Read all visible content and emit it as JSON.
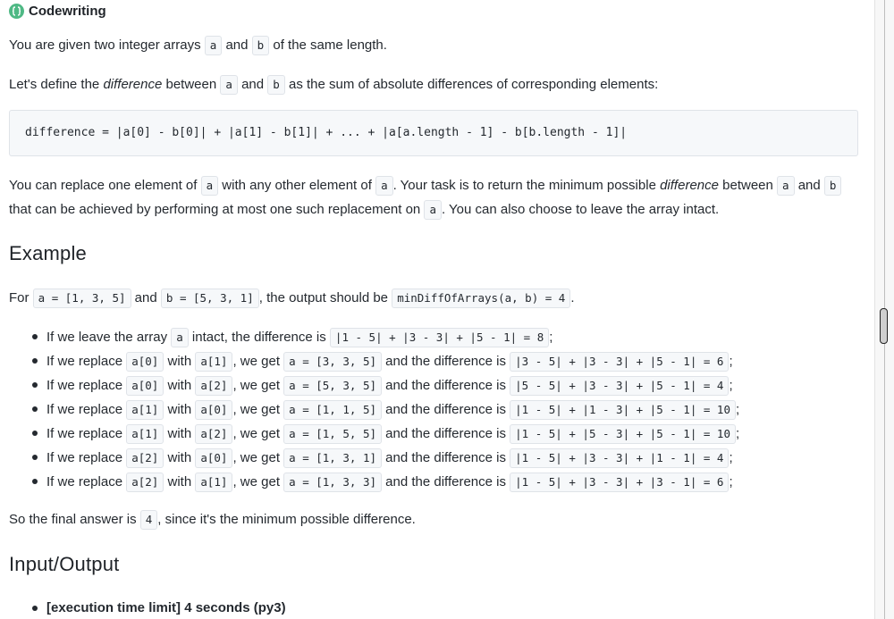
{
  "header": {
    "title": "Codewriting",
    "icon": "codewriting-logo-icon",
    "accent": "#4fb985"
  },
  "intro": {
    "t1": "You are given two integer arrays ",
    "c1": "a",
    "t2": " and ",
    "c2": "b",
    "t3": " of the same length."
  },
  "definition": {
    "t1": "Let's define the ",
    "em": "difference",
    "t2": " between ",
    "c1": "a",
    "t3": " and ",
    "c2": "b",
    "t4": " as the sum of absolute differences of corresponding elements:"
  },
  "codeblock": "difference = |a[0] - b[0]| + |a[1] - b[1]| + ... + |a[a.length - 1] - b[b.length - 1]|",
  "task": {
    "l1_t1": "You can replace one element of ",
    "l1_c1": "a",
    "l1_t2": " with any other element of ",
    "l1_c2": "a",
    "l1_t3": ". Your task is to return the minimum possible ",
    "l1_em": "difference",
    "l1_t4": " between ",
    "l1_c3": "a",
    "l1_t5": " and ",
    "l1_c4": "b",
    "l2_t1": "that can be achieved by performing at most one such replacement on ",
    "l2_c1": "a",
    "l2_t2": ". You can also choose to leave the array intact."
  },
  "example": {
    "heading": "Example",
    "t1": "For ",
    "c1": "a = [1, 3, 5]",
    "t2": " and ",
    "c2": "b = [5, 3, 1]",
    "t3": ", the output should be ",
    "c3": "minDiffOfArrays(a, b) = 4",
    "t4": ".",
    "items": [
      {
        "t1": "If we leave the array ",
        "c1": "a",
        "t2": " intact, the difference is ",
        "c2": "|1 - 5| + |3 - 3| + |5 - 1| = 8",
        "t3": ";"
      },
      {
        "t1": "If we replace ",
        "c1": "a[0]",
        "t2": " with ",
        "c2": "a[1]",
        "t3": ", we get ",
        "c3": "a = [3, 3, 5]",
        "t4": " and the difference is ",
        "c4": "|3 - 5| + |3 - 3| + |5 - 1| = 6",
        "t5": ";"
      },
      {
        "t1": "If we replace ",
        "c1": "a[0]",
        "t2": " with ",
        "c2": "a[2]",
        "t3": ", we get ",
        "c3": "a = [5, 3, 5]",
        "t4": " and the difference is ",
        "c4": "|5 - 5| + |3 - 3| + |5 - 1| = 4",
        "t5": ";"
      },
      {
        "t1": "If we replace ",
        "c1": "a[1]",
        "t2": " with ",
        "c2": "a[0]",
        "t3": ", we get ",
        "c3": "a = [1, 1, 5]",
        "t4": " and the difference is ",
        "c4": "|1 - 5| + |1 - 3| + |5 - 1| = 10",
        "t5": ";"
      },
      {
        "t1": "If we replace ",
        "c1": "a[1]",
        "t2": " with ",
        "c2": "a[2]",
        "t3": ", we get ",
        "c3": "a = [1, 5, 5]",
        "t4": " and the difference is ",
        "c4": "|1 - 5| + |5 - 3| + |5 - 1| = 10",
        "t5": ";"
      },
      {
        "t1": "If we replace ",
        "c1": "a[2]",
        "t2": " with ",
        "c2": "a[0]",
        "t3": ", we get ",
        "c3": "a = [1, 3, 1]",
        "t4": " and the difference is ",
        "c4": "|1 - 5| + |3 - 3| + |1 - 1| = 4",
        "t5": ";"
      },
      {
        "t1": "If we replace ",
        "c1": "a[2]",
        "t2": " with ",
        "c2": "a[1]",
        "t3": ", we get ",
        "c3": "a = [1, 3, 3]",
        "t4": " and the difference is ",
        "c4": "|1 - 5| + |3 - 3| + |3 - 1| = 6",
        "t5": ";"
      }
    ],
    "final_t1": "So the final answer is ",
    "final_c1": "4",
    "final_t2": ", since it's the minimum possible difference."
  },
  "io": {
    "heading": "Input/Output",
    "item1": "[execution time limit] 4 seconds (py3)"
  }
}
